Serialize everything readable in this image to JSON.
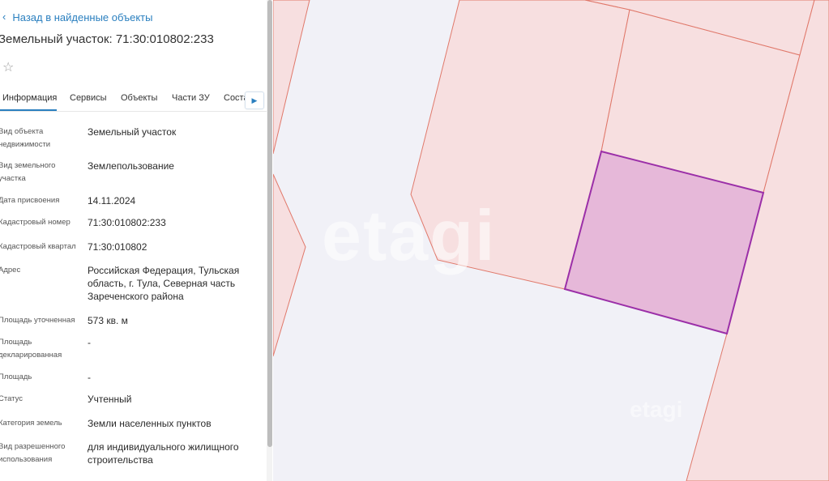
{
  "panel": {
    "back_link": "Назад в найденные объекты",
    "title": "Земельный участок: 71:30:010802:233",
    "favorite_icon": "star-outline-icon",
    "tabs": [
      "Информация",
      "Сервисы",
      "Объекты",
      "Части ЗУ",
      "Соста"
    ],
    "active_tab": "Информация",
    "fields": [
      {
        "label": "Вид объекта недвижимости",
        "value": "Земельный участок"
      },
      {
        "label": "Вид земельного участка",
        "value": "Землепользование"
      },
      {
        "label": "Дата присвоения",
        "value": "14.11.2024"
      },
      {
        "label": "Кадастровый номер",
        "value": "71:30:010802:233"
      },
      {
        "label": "Кадастровый квартал",
        "value": "71:30:010802"
      },
      {
        "label": "Адрес",
        "value": "Российская Федерация, Тульская область, г. Тула, Северная часть Зареченского района"
      },
      {
        "label": "Площадь уточненная",
        "value": "573 кв. м"
      },
      {
        "label": "Площадь декларированная",
        "value": "-"
      },
      {
        "label": "Площадь",
        "value": "-"
      },
      {
        "label": "Статус",
        "value": "Учтенный"
      },
      {
        "label": "Категория земель",
        "value": "Земли населенных пунктов"
      },
      {
        "label": "Вид разрешенного использования",
        "value": "для индивидуального жилищного строительства"
      }
    ]
  },
  "map": {
    "watermark": "etagi",
    "watermark_small": "etagi",
    "colors": {
      "background": "#f1f1f7",
      "parcel_fill": "#f7dfe0",
      "parcel_stroke": "#e0786a",
      "selected_fill": "#e6b8d9",
      "selected_stroke": "#9b2fa8"
    }
  }
}
